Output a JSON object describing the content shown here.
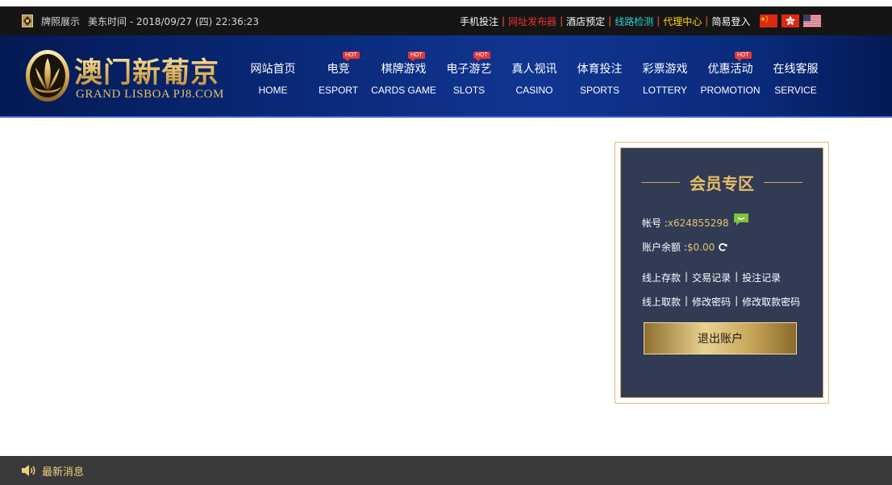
{
  "topbar": {
    "license_label": "牌照展示",
    "time_label": "美东时间 - 2018/09/27 (四) 22:36:23",
    "links": [
      {
        "label": "手机投注",
        "color": "#ffffff"
      },
      {
        "label": "网址发布器",
        "color": "#e8322f"
      },
      {
        "label": "酒店预定",
        "color": "#ffffff"
      },
      {
        "label": "线路检测",
        "color": "#2ad3d1"
      },
      {
        "label": "代理中心",
        "color": "#ffd700"
      },
      {
        "label": "简易登入",
        "color": "#ffffff"
      }
    ],
    "flags": [
      "china-flag",
      "hongkong-flag",
      "usa-flag"
    ]
  },
  "logo": {
    "cn": "澳门新葡京",
    "en": "GRAND LISBOA PJ8.COM"
  },
  "nav": [
    {
      "cn": "网站首页",
      "en": "HOME",
      "hot": false
    },
    {
      "cn": "电竞",
      "en": "ESPORT",
      "hot": true
    },
    {
      "cn": "棋牌游戏",
      "en": "CARDS GAME",
      "hot": true
    },
    {
      "cn": "电子游艺",
      "en": "SLOTS",
      "hot": true
    },
    {
      "cn": "真人视讯",
      "en": "CASINO",
      "hot": false
    },
    {
      "cn": "体育投注",
      "en": "SPORTS",
      "hot": false
    },
    {
      "cn": "彩票游戏",
      "en": "LOTTERY",
      "hot": false
    },
    {
      "cn": "优惠活动",
      "en": "PROMOTION",
      "hot": true
    },
    {
      "cn": "在线客服",
      "en": "SERVICE",
      "hot": false
    }
  ],
  "hot_label": "HOT",
  "member": {
    "title": "会员专区",
    "account_label": "帐号 : ",
    "account_value": "x624855298",
    "balance_label": "账户余额 : ",
    "balance_value": "$0.00",
    "links_row1": [
      "线上存款",
      "交易记录",
      "投注记录"
    ],
    "links_row2": [
      "线上取款",
      "修改密码",
      "修改取款密码"
    ],
    "separator": "|",
    "logout_label": "退出账户"
  },
  "footer": {
    "news_label": "最新消息"
  },
  "colors": {
    "accent_gold": "#e7bf6a",
    "header_blue": "#0a2a7a",
    "panel_bg": "#313b54"
  }
}
